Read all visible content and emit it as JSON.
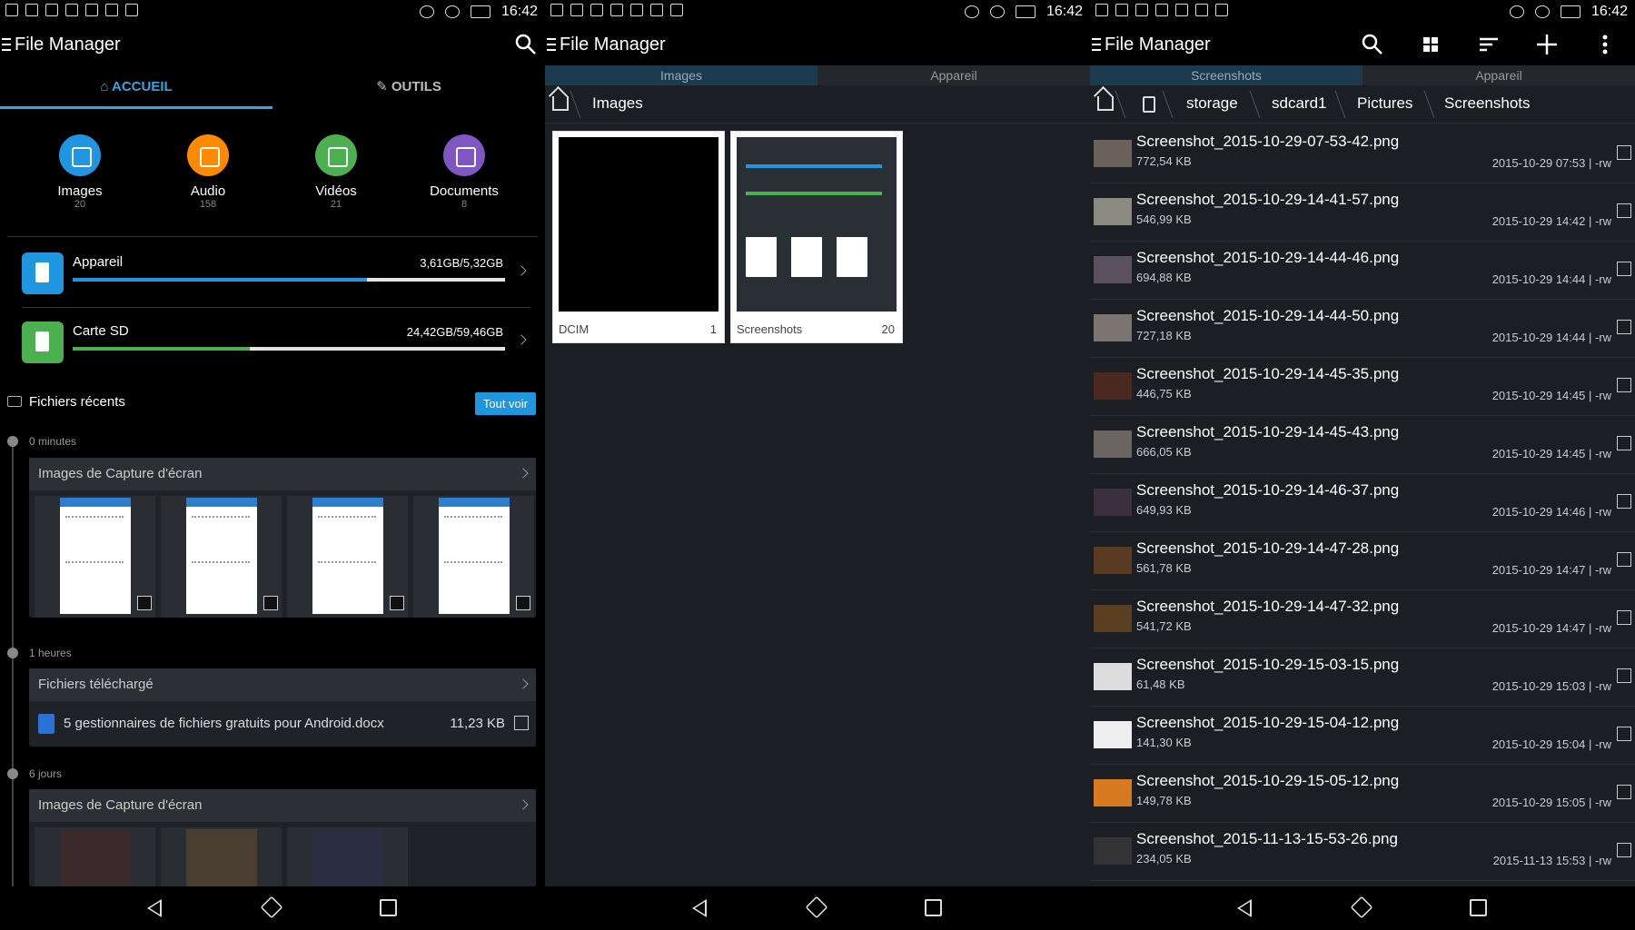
{
  "status": {
    "time": "16:42"
  },
  "screen1": {
    "app_title": "File Manager",
    "tabs": [
      "ACCUEIL",
      "OUTILS"
    ],
    "categories": [
      {
        "label": "Images",
        "count": "20",
        "color": "#2196e0"
      },
      {
        "label": "Audio",
        "count": "158",
        "color": "#ff8a00"
      },
      {
        "label": "Vidéos",
        "count": "21",
        "color": "#4caf50"
      },
      {
        "label": "Documents",
        "count": "8",
        "color": "#7e57c2"
      }
    ],
    "storage": [
      {
        "name": "Appareil",
        "size": "3,61GB/5,32GB",
        "fill_pct": 68,
        "color": "#2196e0"
      },
      {
        "name": "Carte SD",
        "size": "24,42GB/59,46GB",
        "fill_pct": 41,
        "color": "#4caf50"
      }
    ],
    "recent_title": "Fichiers récents",
    "see_all": "Tout voir",
    "timeline": [
      {
        "label": "0 minutes",
        "group": "Images de Capture d'écran"
      },
      {
        "label": "1 heures",
        "group": "Fichiers téléchargé",
        "file": {
          "name": "5 gestionnaires de fichiers gratuits pour Android.docx",
          "size": "11,23 KB"
        }
      },
      {
        "label": "6 jours",
        "group": "Images de Capture d'écran"
      }
    ]
  },
  "screen2": {
    "app_title": "File Manager",
    "tabs": [
      "Images",
      "Appareil"
    ],
    "breadcrumb": [
      "Images"
    ],
    "folders": [
      {
        "name": "DCIM",
        "count": "1"
      },
      {
        "name": "Screenshots",
        "count": "20"
      }
    ]
  },
  "screen3": {
    "app_title": "File Manager",
    "tabs": [
      "Screenshots",
      "Appareil"
    ],
    "breadcrumb": [
      "storage",
      "sdcard1",
      "Pictures",
      "Screenshots"
    ],
    "files": [
      {
        "name": "Screenshot_2015-10-29-07-53-42.png",
        "size": "772,54 KB",
        "date": "2015-10-29 07:53 | -rw"
      },
      {
        "name": "Screenshot_2015-10-29-14-41-57.png",
        "size": "546,99 KB",
        "date": "2015-10-29 14:42 | -rw"
      },
      {
        "name": "Screenshot_2015-10-29-14-44-46.png",
        "size": "694,88 KB",
        "date": "2015-10-29 14:44 | -rw"
      },
      {
        "name": "Screenshot_2015-10-29-14-44-50.png",
        "size": "727,18 KB",
        "date": "2015-10-29 14:44 | -rw"
      },
      {
        "name": "Screenshot_2015-10-29-14-45-35.png",
        "size": "446,75 KB",
        "date": "2015-10-29 14:45 | -rw"
      },
      {
        "name": "Screenshot_2015-10-29-14-45-43.png",
        "size": "666,05 KB",
        "date": "2015-10-29 14:45 | -rw"
      },
      {
        "name": "Screenshot_2015-10-29-14-46-37.png",
        "size": "649,93 KB",
        "date": "2015-10-29 14:46 | -rw"
      },
      {
        "name": "Screenshot_2015-10-29-14-47-28.png",
        "size": "561,78 KB",
        "date": "2015-10-29 14:47 | -rw"
      },
      {
        "name": "Screenshot_2015-10-29-14-47-32.png",
        "size": "541,72 KB",
        "date": "2015-10-29 14:47 | -rw"
      },
      {
        "name": "Screenshot_2015-10-29-15-03-15.png",
        "size": "61,48 KB",
        "date": "2015-10-29 15:03 | -rw"
      },
      {
        "name": "Screenshot_2015-10-29-15-04-12.png",
        "size": "141,30 KB",
        "date": "2015-10-29 15:04 | -rw"
      },
      {
        "name": "Screenshot_2015-10-29-15-05-12.png",
        "size": "149,78 KB",
        "date": "2015-10-29 15:05 | -rw"
      },
      {
        "name": "Screenshot_2015-11-13-15-53-26.png",
        "size": "234,05 KB",
        "date": "2015-11-13 15:53 | -rw"
      }
    ]
  }
}
